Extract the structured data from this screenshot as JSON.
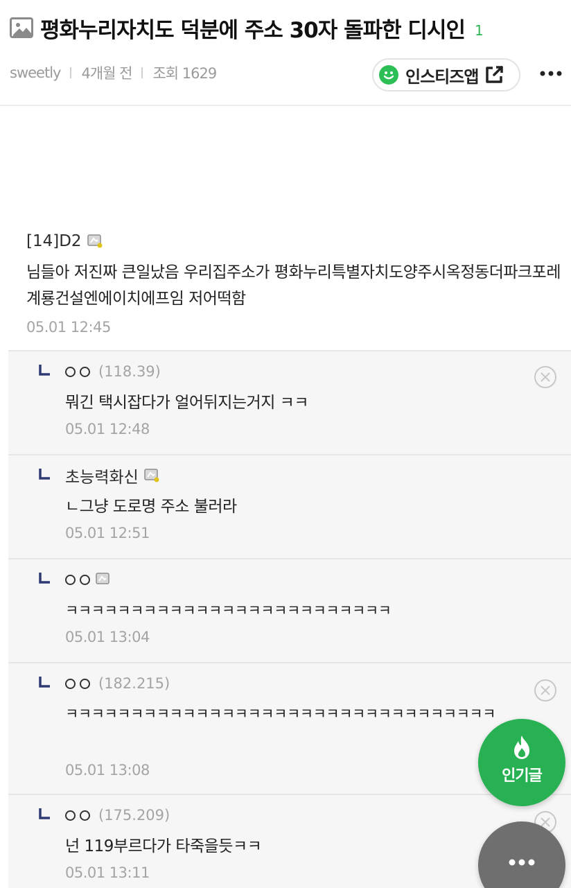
{
  "header": {
    "title": "평화누리자치도 덕분에 주소 30자 돌파한 디시인",
    "comment_count": "1",
    "author": "sweetly",
    "posted": "4개월 전",
    "views": "조회 1629",
    "app_button_label": "인스티즈앱"
  },
  "capture": {
    "main_comment": {
      "author": "[14]D2",
      "text": "님들아 저진짜 큰일났음 우리집주소가 평화누리특별자치도양주시옥정동더파크포레계룡건설엔에이치에프임 저어떡함",
      "time": "05.01 12:45"
    },
    "replies": [
      {
        "author": "ㅇㅇ",
        "ip": "(118.39)",
        "text": "뭐긴 택시잡다가 얼어뒤지는거지 ㅋㅋ",
        "time": "05.01 12:48"
      },
      {
        "author": "초능력화신",
        "ip": "",
        "text": "ㄴ그냥 도로명 주소 불러라",
        "time": "05.01 12:51"
      },
      {
        "author": "ㅇㅇ",
        "ip": "",
        "text": "ㅋㅋㅋㅋㅋㅋㅋㅋㅋㅋㅋㅋㅋㅋㅋㅋㅋㅋㅋㅋㅋㅋㅋㅋㅋ",
        "time": "05.01 13:04"
      },
      {
        "author": "ㅇㅇ",
        "ip": "(182.215)",
        "text": "ㅋㅋㅋㅋㅋㅋㅋㅋㅋㅋㅋㅋㅋㅋㅋㅋㅋㅋㅋㅋㅋㅋㅋㅋㅋㅋㅋㅋㅋㅋㅋㅋㅋ",
        "time": "05.01 13:08"
      },
      {
        "author": "ㅇㅇ",
        "ip": "(175.209)",
        "text": "넌 119부르다가 타죽을듯ㅋㅋ",
        "time": "05.01 13:11"
      }
    ]
  },
  "fab": {
    "popular_label": "인기글"
  },
  "icons": {
    "title": "image-icon",
    "app": "smile-icon",
    "external": "external-link-icon",
    "more": "more-dots-icon",
    "popular": "flame-icon",
    "close": "close-circle-icon",
    "reply": "reply-arrow-icon",
    "badge": "gallery-badge-icon"
  },
  "colors": {
    "brand_green": "#27b152",
    "reply_mark": "#2e3a74",
    "muted": "#a4a4a4"
  }
}
